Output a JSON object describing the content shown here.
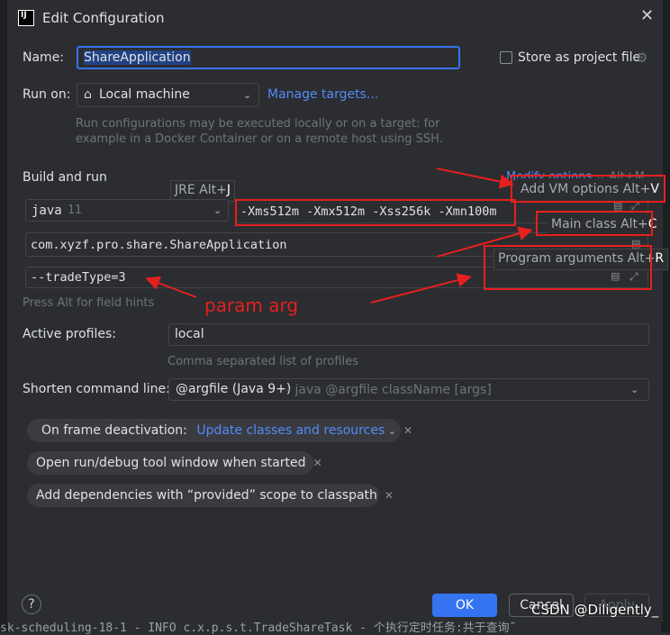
{
  "dialog": {
    "title": "Edit Configuration",
    "app_icon": "IJ"
  },
  "name": {
    "label": "Name:",
    "value": "ShareApplication"
  },
  "store_label": "Store as project file",
  "run_on": {
    "label": "Run on:",
    "value": "Local machine",
    "manage_link": "Manage targets...",
    "help_line1": "Run configurations may be executed locally or on a target: for",
    "help_line2": "example in a Docker Container or on a remote host using SSH."
  },
  "build": {
    "section": "Build and run",
    "modify_options": "Modify options",
    "modify_shortcut": "Alt+M",
    "jre_tip": "JRE Alt+",
    "jre_key": "J",
    "java_name": "java",
    "java_version": "11",
    "vm_options": "-Xms512m -Xmx512m -Xss256k  -Xmn100m",
    "add_vm_tip": "Add VM options Alt+",
    "add_vm_key": "V",
    "main_class": "com.xyzf.pro.share.ShareApplication",
    "main_class_tip": "Main class Alt+",
    "main_class_key": "C",
    "program_args": "--tradeType=3",
    "program_args_tip": "Program arguments Alt+",
    "program_args_key": "R",
    "field_hints": "Press Alt for field hints",
    "annotation": "param arg"
  },
  "profiles": {
    "label": "Active profiles:",
    "value": "local",
    "hint": "Comma separated list of profiles"
  },
  "shorten": {
    "label": "Shorten command line:",
    "value": "@argfile (Java 9+)",
    "hint": " - java @argfile className [args]"
  },
  "options": {
    "frame_label": "On frame deactivation:",
    "frame_value": "Update classes and resources",
    "open_window": "Open run/debug tool window when started",
    "add_deps": "Add dependencies with “provided” scope to classpath"
  },
  "buttons": {
    "help": "?",
    "ok": "OK",
    "cancel": "Cancel",
    "apply": "Apply"
  },
  "watermark": "CSDN @Diligently_",
  "background_log": "sk-scheduling-18-1 - INFO  c.x.p.s.t.TradeShareTask - 个执行定时任务:共于查询῀"
}
